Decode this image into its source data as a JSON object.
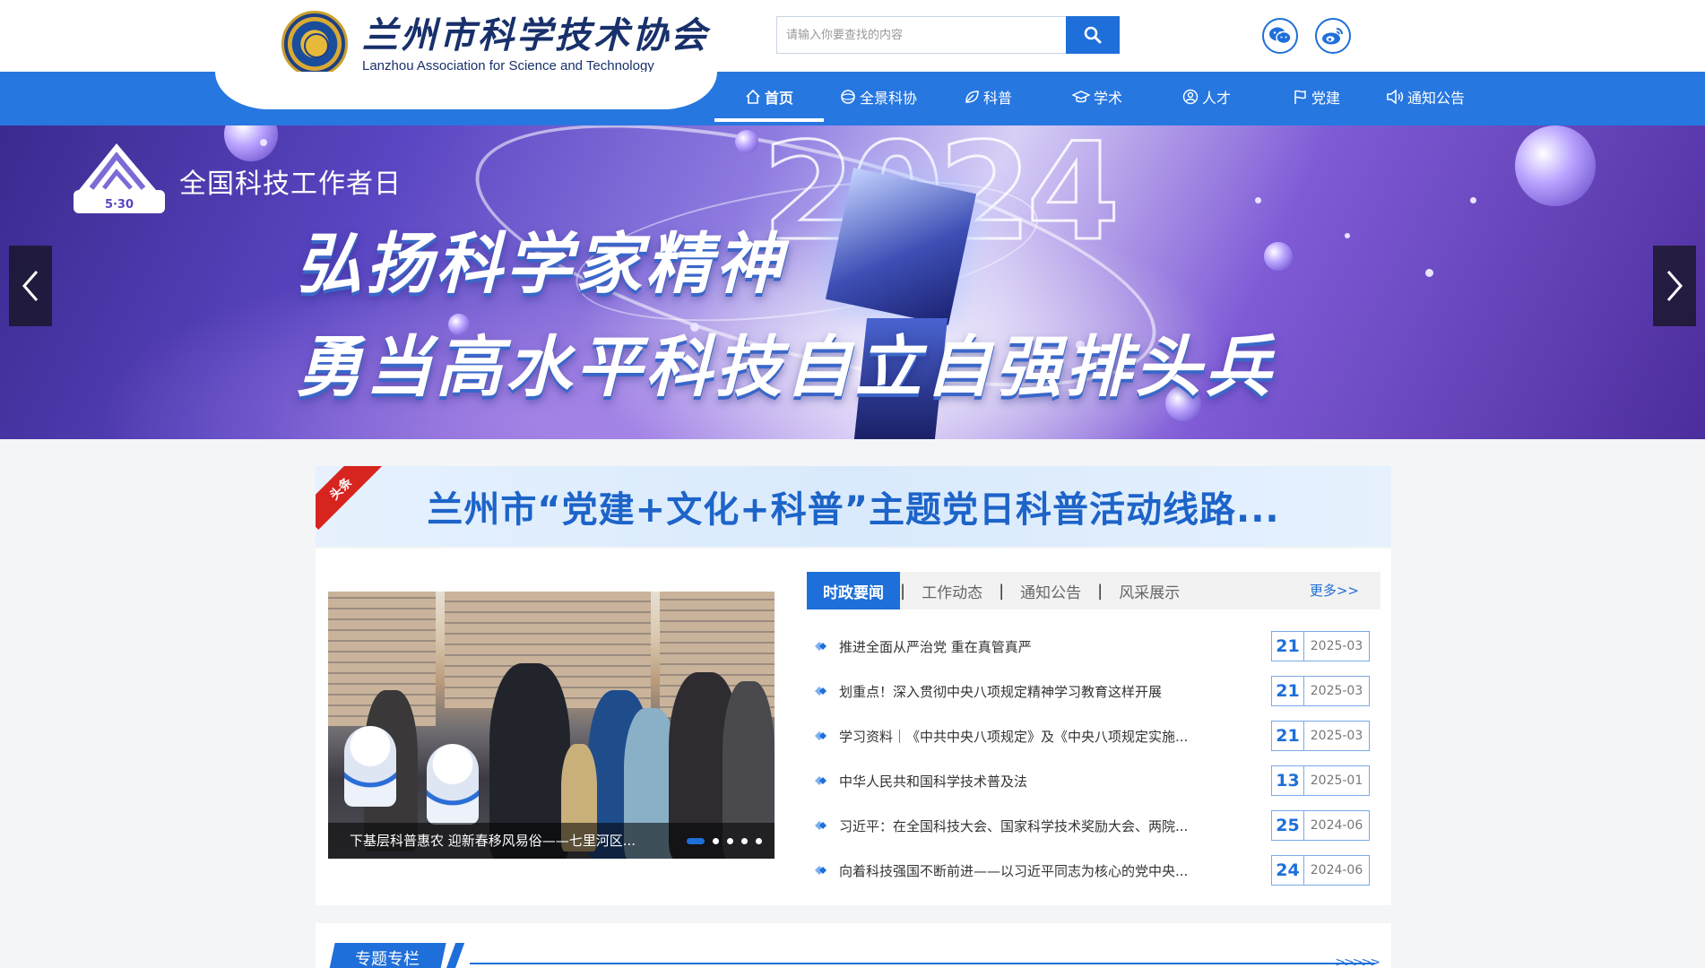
{
  "header": {
    "org_name_cn": "兰州市科学技术协会",
    "org_name_en": "Lanzhou Association for Science and Technology",
    "search_placeholder": "请输入你要查找的内容",
    "social": [
      {
        "icon": "wechat-icon"
      },
      {
        "icon": "weibo-icon"
      }
    ]
  },
  "nav": {
    "items": [
      {
        "label": "首页",
        "icon": "home-icon",
        "active": true
      },
      {
        "label": "全景科协",
        "icon": "panorama-icon",
        "active": false
      },
      {
        "label": "科普",
        "icon": "leaf-icon",
        "active": false
      },
      {
        "label": "学术",
        "icon": "graduation-cap-icon",
        "active": false
      },
      {
        "label": "人才",
        "icon": "talent-icon",
        "active": false
      },
      {
        "label": "党建",
        "icon": "flag-icon",
        "active": false
      },
      {
        "label": "通知公告",
        "icon": "speaker-icon",
        "active": false
      }
    ]
  },
  "banner": {
    "year": "2024",
    "badge_label": "全国科技工作者日",
    "badge_date": "5·30",
    "slogan_line1": "弘扬科学家精神",
    "slogan_line2": "勇当高水平科技自立自强排头兵"
  },
  "headline": {
    "ribbon": "头条",
    "title": "兰州市“党建+文化+科普”主题党日科普活动线路..."
  },
  "news": {
    "photo_caption": "下基层科普惠农 迎新春移风易俗——七里河区...",
    "photo_dot_count": 5,
    "photo_active_dot": 0,
    "tabs": [
      "时政要闻",
      "工作动态",
      "通知公告",
      "风采展示"
    ],
    "active_tab": 0,
    "separator": "|",
    "more_label": "更多>>",
    "items": [
      {
        "title": "推进全面从严治党 重在真管真严",
        "day": "21",
        "ym": "2025-03"
      },
      {
        "title": "划重点！深入贯彻中央八项规定精神学习教育这样开展",
        "day": "21",
        "ym": "2025-03"
      },
      {
        "title": "学习资料｜《中共中央八项规定》及《中央八项规定实施...",
        "day": "21",
        "ym": "2025-03"
      },
      {
        "title": "中华人民共和国科学技术普及法",
        "day": "13",
        "ym": "2025-01"
      },
      {
        "title": "习近平：在全国科技大会、国家科学技术奖励大会、两院...",
        "day": "25",
        "ym": "2024-06"
      },
      {
        "title": "向着科技强国不断前进——以习近平同志为核心的党中央...",
        "day": "24",
        "ym": "2024-06"
      }
    ]
  },
  "special": {
    "title": "专题专栏",
    "arrows": ">>>>>"
  },
  "colors": {
    "primary": "#1e6fd9",
    "nav_bar": "#2777e0",
    "headline_text": "#1d64c9",
    "ribbon": "#d7241f"
  }
}
